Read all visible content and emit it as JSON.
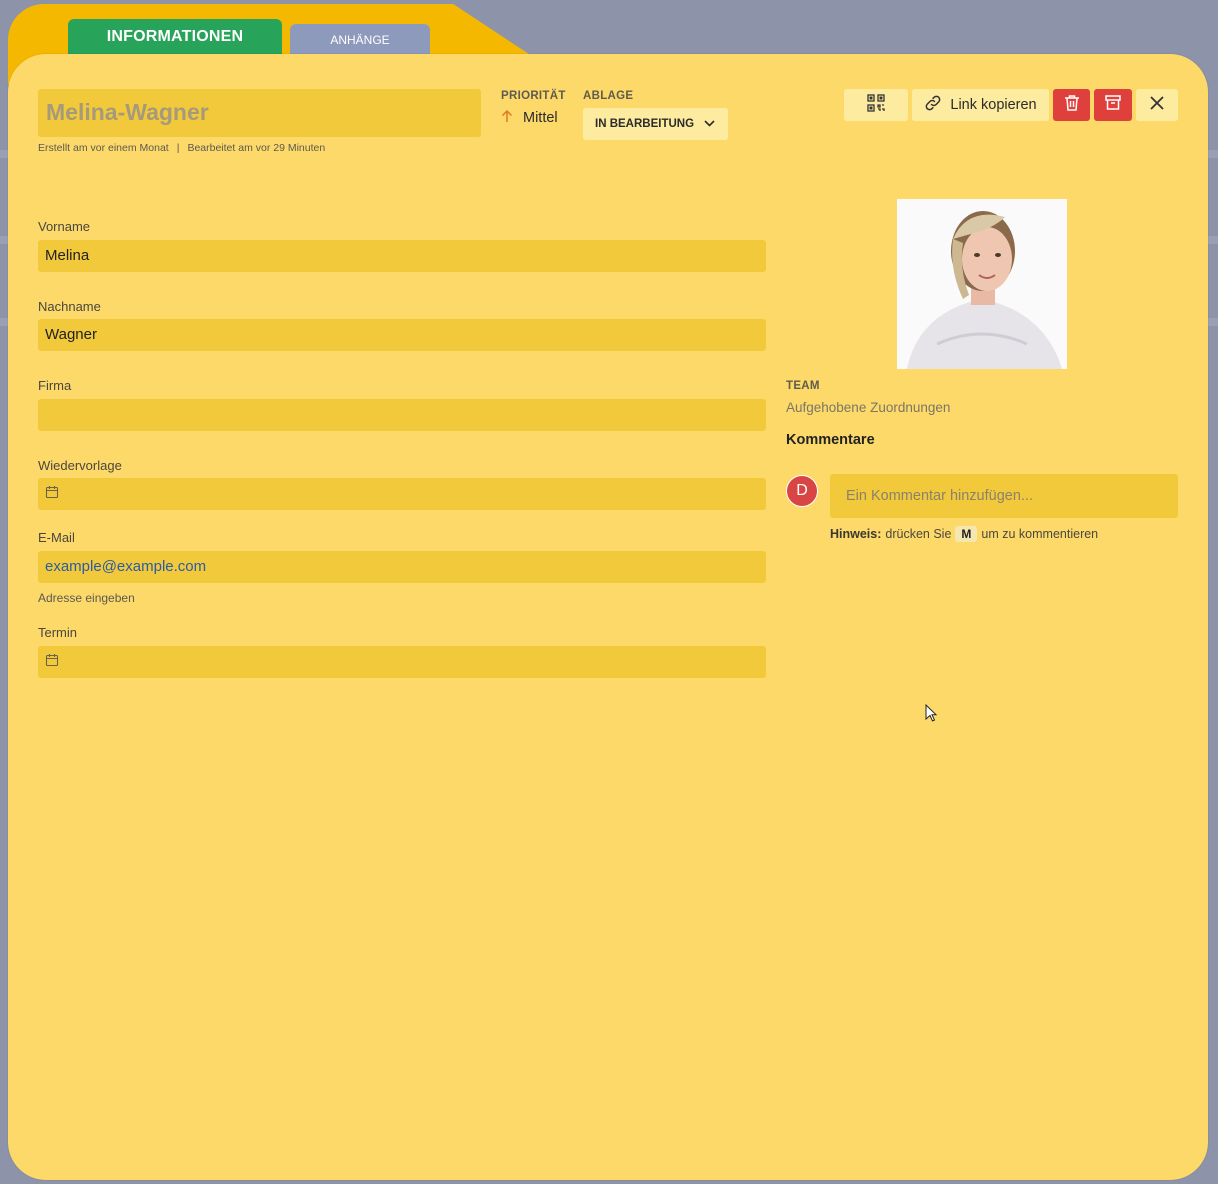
{
  "tabs": {
    "info_label": "INFORMATIONEN",
    "attachments_label": "ANHÄNGE"
  },
  "record": {
    "title": "Melina-Wagner",
    "created": "Erstellt am vor einem Monat",
    "edited": "Bearbeitet am vor 29 Minuten"
  },
  "priority": {
    "label": "PRIORITÄT",
    "value": "Mittel",
    "icon": "arrow-up-icon",
    "color": "#e07a1a"
  },
  "ablage": {
    "label": "ABLAGE",
    "value": "IN BEARBEITUNG"
  },
  "toolbar": {
    "link_label": "Link kopieren",
    "qr_icon": "qr-code-icon",
    "trash_icon": "trash-icon",
    "archive_icon": "archive-icon",
    "close_icon": "close-icon",
    "danger_color": "#e0403c"
  },
  "form": {
    "vorname_label": "Vorname",
    "vorname_value": "Melina",
    "nachname_label": "Nachname",
    "nachname_value": "Wagner",
    "firma_label": "Firma",
    "firma_value": "",
    "wiedervorlage_label": "Wiedervorlage",
    "wiedervorlage_value": "",
    "email_label": "E-Mail",
    "email_value": "example@example.com",
    "email_hint": "Adresse eingeben",
    "termin_label": "Termin",
    "termin_value": ""
  },
  "team": {
    "label": "TEAM",
    "value": "Aufgehobene Zuordnungen"
  },
  "comments": {
    "title": "Kommentare",
    "avatar_letter": "D",
    "placeholder": "Ein Kommentar hinzufügen...",
    "hint_bold": "Hinweis:",
    "hint_pre": "drücken Sie",
    "hint_key": "M",
    "hint_post": "um zu kommentieren"
  },
  "colors": {
    "card": "#fdd96a",
    "field": "#f1c93a",
    "tab_active": "#27a35a",
    "tab_inactive": "#8e9abc"
  }
}
